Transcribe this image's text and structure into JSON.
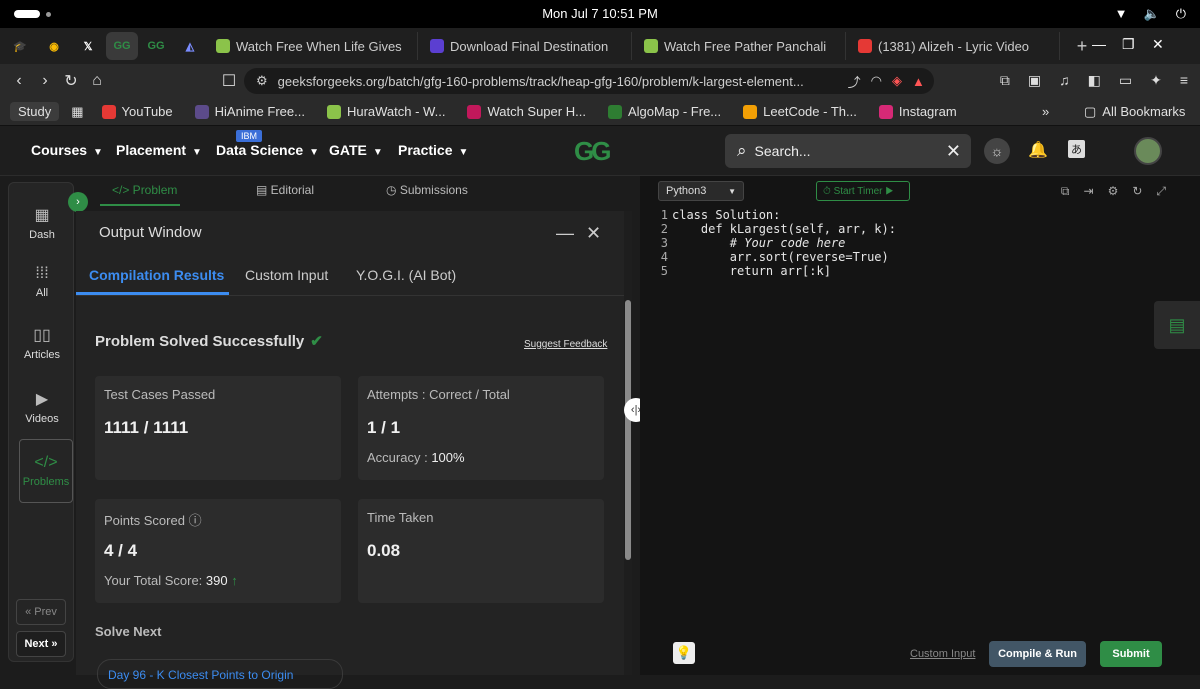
{
  "os": {
    "clock": "Mon Jul 7  10:51 PM"
  },
  "browser": {
    "tabs": [
      {
        "label": "Watch Free When Life Gives",
        "color": "#8bc34a"
      },
      {
        "label": "Download Final Destination",
        "color": "#5b3fd1"
      },
      {
        "label": "Watch Free Pather Panchali",
        "color": "#8bc34a"
      },
      {
        "label": "(1381) Alizeh - Lyric Video",
        "color": "#e53935"
      }
    ],
    "new_tab": "+",
    "url": "geeksforgeeks.org/batch/gfg-160-problems/track/heap-gfg-160/problem/k-largest-element...",
    "bookmarks": [
      {
        "label": "YouTube",
        "color": "#e53935"
      },
      {
        "label": "HiAnime Free...",
        "color": "#5c4b8a"
      },
      {
        "label": "HuraWatch - W...",
        "color": "#8bc34a"
      },
      {
        "label": "Watch Super H...",
        "color": "#c2185b"
      },
      {
        "label": "AlgoMap - Fre...",
        "color": "#2e7d32"
      },
      {
        "label": "LeetCode - Th...",
        "color": "#f29f05"
      },
      {
        "label": "Instagram",
        "color": "#d62976"
      }
    ],
    "study": "Study",
    "more": "»",
    "all_bookmarks": "All Bookmarks"
  },
  "gfg": {
    "menus": [
      "Courses",
      "Placement",
      "Data Science",
      "GATE",
      "Practice"
    ],
    "ibm_badge": "IBM",
    "logo": "GG",
    "search_placeholder": "Search..."
  },
  "rail": {
    "items": [
      {
        "label": "Dash",
        "icon": "grid-icon"
      },
      {
        "label": "All",
        "icon": "apps-icon"
      },
      {
        "label": "Articles",
        "icon": "book-icon"
      },
      {
        "label": "Videos",
        "icon": "play-icon"
      },
      {
        "label": "Problems",
        "icon": "code-icon"
      }
    ],
    "prev": "« Prev",
    "next": "Next »"
  },
  "problem_tabs": {
    "problem": "</> Problem",
    "editorial": "Editorial",
    "submissions": "Submissions"
  },
  "output": {
    "title": "Output Window",
    "tabs": [
      "Compilation Results",
      "Custom Input",
      "Y.O.G.I. (AI Bot)"
    ],
    "status": "Problem Solved Successfully",
    "suggest": "Suggest Feedback",
    "cards": {
      "tests_label": "Test Cases Passed",
      "tests_value": "1111 / 1111",
      "attempts_label": "Attempts : Correct / Total",
      "attempts_value": "1 / 1",
      "accuracy_label": "Accuracy :",
      "accuracy_value": "100%",
      "points_label": "Points Scored",
      "points_value": "4 / 4",
      "total_label": "Your Total Score:",
      "total_value": "390",
      "time_label": "Time Taken",
      "time_value": "0.08"
    },
    "solve_next": "Solve Next",
    "next_problem": "Day 96 - K Closest Points to Origin"
  },
  "editor": {
    "language": "Python3",
    "timer": "Start Timer",
    "code": [
      {
        "n": "1",
        "line": "class Solution:"
      },
      {
        "n": "2",
        "line": "    def kLargest(self, arr, k):"
      },
      {
        "n": "3",
        "line": "        # Your code here"
      },
      {
        "n": "4",
        "line": "        arr.sort(reverse=True)"
      },
      {
        "n": "5",
        "line": "        return arr[:k]"
      }
    ],
    "custom_input": "Custom Input",
    "compile_run": "Compile & Run",
    "submit": "Submit"
  }
}
